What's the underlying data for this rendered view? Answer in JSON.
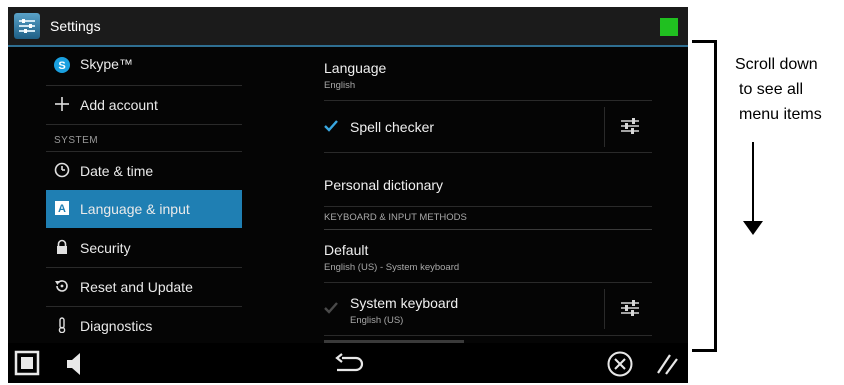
{
  "titlebar": {
    "title": "Settings",
    "app_icon": "settings-sliders-icon",
    "status_color": "#20c020"
  },
  "sidebar": {
    "account_items": [
      {
        "label": "Skype™",
        "icon": "skype-icon"
      },
      {
        "label": "Add account",
        "icon": "plus-icon"
      }
    ],
    "system_header": "SYSTEM",
    "system_items": [
      {
        "label": "Date & time",
        "icon": "clock-icon",
        "selected": false
      },
      {
        "label": "Language & input",
        "icon": "keyboard-a-icon",
        "selected": true
      },
      {
        "label": "Security",
        "icon": "lock-icon",
        "selected": false
      },
      {
        "label": "Reset and Update",
        "icon": "reset-icon",
        "selected": false
      },
      {
        "label": "Diagnostics",
        "icon": "thermometer-icon",
        "selected": false
      }
    ]
  },
  "pane": {
    "language": {
      "title": "Language",
      "value": "English"
    },
    "spell_checker": {
      "title": "Spell checker",
      "checked": true
    },
    "personal_dictionary": {
      "title": "Personal dictionary"
    },
    "keyboard_section": "KEYBOARD & INPUT METHODS",
    "default": {
      "title": "Default",
      "value": "English (US) - System keyboard"
    },
    "system_keyboard": {
      "title": "System keyboard",
      "value": "English (US)",
      "checked": true
    }
  },
  "navbar": {
    "icons": [
      "screen-square-icon",
      "speaker-icon",
      "back-arrow-icon",
      "close-circle-icon",
      "resize-handle-icon"
    ]
  },
  "annotation": {
    "lines": [
      "Scroll down",
      "to see all",
      "menu items"
    ]
  },
  "colors": {
    "accent": "#1f7fb3",
    "title_border": "#2f6f92"
  }
}
